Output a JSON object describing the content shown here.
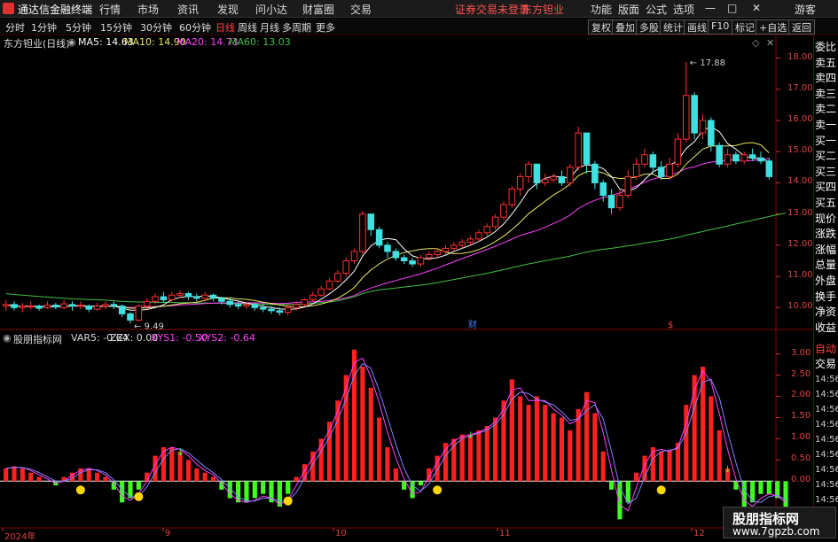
{
  "app_title": "通达信金融终端",
  "menu": [
    "行情",
    "市场",
    "资讯",
    "发现",
    "问小达",
    "财富圈",
    "交易"
  ],
  "notice": "证券交易未登录",
  "stock_name_top": "东方钽业",
  "menu_right": [
    "功能",
    "版面",
    "公式",
    "选项"
  ],
  "guest": "游客",
  "periods": [
    "分时",
    "1分钟",
    "5分钟",
    "15分钟",
    "30分钟",
    "60分钟",
    "日线",
    "周线",
    "月线",
    "多周期",
    "更多"
  ],
  "active_period": "日线",
  "toolbar_buttons": [
    "复权",
    "叠加",
    "多股",
    "统计",
    "画线",
    "F10",
    "标记",
    "+自选",
    "返回"
  ],
  "main_legend": {
    "title": "东方钽业(日线)",
    "ma5": "MA5: 14.63",
    "ma10": "MA10: 14.90",
    "ma20": "MA20: 14.73",
    "ma60": "MA60: 13.03"
  },
  "colors": {
    "ma5": "#ffffff",
    "ma10": "#e8e864",
    "ma20": "#ff40ff",
    "ma60": "#40c040",
    "up": "#ff3030",
    "down": "#40e0e0",
    "axis": "#d43030"
  },
  "price_axis": [
    "18.00",
    "17.00",
    "16.00",
    "15.00",
    "14.00",
    "13.00",
    "12.00",
    "11.00",
    "10.00"
  ],
  "high_mark": "17.88",
  "low_mark": "9.49",
  "chart_marks": [
    "财",
    "$"
  ],
  "indicator_legend": {
    "title": "股朋指标网",
    "var5": "VAR5: -0.64",
    "zzx": "ZZX: 0.00",
    "xys1": "XYS1: -0.50",
    "xys2": "XYS2: -0.64"
  },
  "ind_axis": [
    "3.00",
    "2.50",
    "2.00",
    "1.50",
    "1.00",
    "0.50",
    "0.00"
  ],
  "x_axis": [
    "2024年",
    "9",
    "10",
    "11",
    "12"
  ],
  "side_panel": [
    "委比",
    "卖五",
    "卖四",
    "卖三",
    "卖二",
    "卖一",
    "买一",
    "买二",
    "买三",
    "买四",
    "买五",
    "现价",
    "涨跌",
    "涨幅",
    "总量",
    "外盘",
    "换手",
    "净资",
    "收益"
  ],
  "side_lower": [
    "自动",
    "交易",
    "14:56",
    "14:56",
    "14:56",
    "14:56",
    "14:56",
    "14:56",
    "14:56",
    "14:56",
    "14:56"
  ],
  "watermark": {
    "line1": "股朋指标网",
    "line2": "www.7gpzb.com"
  },
  "chart_data": {
    "type": "candlestick",
    "price_ylim": [
      9.3,
      18.3
    ],
    "ind_ylim": [
      -1.1,
      3.2
    ],
    "candles": [
      [
        10.05,
        10.1,
        10.25,
        9.9
      ],
      [
        10.1,
        10.0,
        10.2,
        9.9
      ],
      [
        10.0,
        10.05,
        10.15,
        9.85
      ],
      [
        10.05,
        10.05,
        10.2,
        9.95
      ],
      [
        10.05,
        9.98,
        10.1,
        9.9
      ],
      [
        10.0,
        10.08,
        10.2,
        9.95
      ],
      [
        10.08,
        10.02,
        10.15,
        9.95
      ],
      [
        10.0,
        10.12,
        10.25,
        9.95
      ],
      [
        10.1,
        10.05,
        10.2,
        9.9
      ],
      [
        10.05,
        10.08,
        10.2,
        9.95
      ],
      [
        10.05,
        9.95,
        10.1,
        9.85
      ],
      [
        9.95,
        10.05,
        10.15,
        9.9
      ],
      [
        10.05,
        10.1,
        10.2,
        9.95
      ],
      [
        10.1,
        10.05,
        10.2,
        9.95
      ],
      [
        10.05,
        9.8,
        10.1,
        9.7
      ],
      [
        9.8,
        9.6,
        9.85,
        9.49
      ],
      [
        9.6,
        10.05,
        10.1,
        9.55
      ],
      [
        10.05,
        10.2,
        10.3,
        9.95
      ],
      [
        10.2,
        10.35,
        10.45,
        10.1
      ],
      [
        10.35,
        10.25,
        10.5,
        10.15
      ],
      [
        10.25,
        10.4,
        10.5,
        10.2
      ],
      [
        10.4,
        10.45,
        10.55,
        10.3
      ],
      [
        10.45,
        10.35,
        10.5,
        10.25
      ],
      [
        10.35,
        10.3,
        10.45,
        10.2
      ],
      [
        10.3,
        10.4,
        10.5,
        10.2
      ],
      [
        10.4,
        10.3,
        10.45,
        10.2
      ],
      [
        10.3,
        10.2,
        10.35,
        10.1
      ],
      [
        10.2,
        10.1,
        10.3,
        10.0
      ],
      [
        10.1,
        10.05,
        10.2,
        9.95
      ],
      [
        10.05,
        10.1,
        10.2,
        9.95
      ],
      [
        10.1,
        10.0,
        10.15,
        9.9
      ],
      [
        10.0,
        9.95,
        10.1,
        9.85
      ],
      [
        9.95,
        9.9,
        10.05,
        9.8
      ],
      [
        9.9,
        9.85,
        10.0,
        9.75
      ],
      [
        9.85,
        10.0,
        10.1,
        9.75
      ],
      [
        10.0,
        10.1,
        10.2,
        9.9
      ],
      [
        10.1,
        10.25,
        10.3,
        10.05
      ],
      [
        10.25,
        10.4,
        10.5,
        10.2
      ],
      [
        10.4,
        10.6,
        10.7,
        10.35
      ],
      [
        10.6,
        10.85,
        10.95,
        10.55
      ],
      [
        10.85,
        11.1,
        11.2,
        10.8
      ],
      [
        11.1,
        11.5,
        11.6,
        11.0
      ],
      [
        11.5,
        11.8,
        11.9,
        11.4
      ],
      [
        11.8,
        13.0,
        13.1,
        11.7
      ],
      [
        13.0,
        12.5,
        13.0,
        12.3
      ],
      [
        12.5,
        12.0,
        12.6,
        11.9
      ],
      [
        12.0,
        11.8,
        12.1,
        11.6
      ],
      [
        11.8,
        11.6,
        11.9,
        11.5
      ],
      [
        11.6,
        11.5,
        11.7,
        11.4
      ],
      [
        11.5,
        11.4,
        11.6,
        11.3
      ],
      [
        11.4,
        11.6,
        11.7,
        11.3
      ],
      [
        11.6,
        11.7,
        11.8,
        11.5
      ],
      [
        11.7,
        11.8,
        11.9,
        11.6
      ],
      [
        11.8,
        11.9,
        12.0,
        11.7
      ],
      [
        11.9,
        12.0,
        12.1,
        11.8
      ],
      [
        12.0,
        12.1,
        12.2,
        11.9
      ],
      [
        12.1,
        12.2,
        12.3,
        12.0
      ],
      [
        12.2,
        12.4,
        12.5,
        12.1
      ],
      [
        12.4,
        12.6,
        12.7,
        12.3
      ],
      [
        12.6,
        12.9,
        13.0,
        12.5
      ],
      [
        12.9,
        13.3,
        13.4,
        12.8
      ],
      [
        13.3,
        13.8,
        13.9,
        13.2
      ],
      [
        13.8,
        14.2,
        14.3,
        13.6
      ],
      [
        14.2,
        14.6,
        14.7,
        14.0
      ],
      [
        14.6,
        14.0,
        14.6,
        13.8
      ],
      [
        14.0,
        14.1,
        14.3,
        13.9
      ],
      [
        14.1,
        14.2,
        14.3,
        14.0
      ],
      [
        14.2,
        14.0,
        14.4,
        13.9
      ],
      [
        14.0,
        14.5,
        14.6,
        13.9
      ],
      [
        14.5,
        15.6,
        15.8,
        14.4
      ],
      [
        15.6,
        14.6,
        15.6,
        14.3
      ],
      [
        14.6,
        14.0,
        14.7,
        13.8
      ],
      [
        14.0,
        13.6,
        14.1,
        13.4
      ],
      [
        13.6,
        13.2,
        13.8,
        13.0
      ],
      [
        13.2,
        13.6,
        13.8,
        13.1
      ],
      [
        13.6,
        14.2,
        14.4,
        13.5
      ],
      [
        14.2,
        14.6,
        14.8,
        14.1
      ],
      [
        14.6,
        14.9,
        15.1,
        14.5
      ],
      [
        14.9,
        14.5,
        15.0,
        14.3
      ],
      [
        14.5,
        14.2,
        14.7,
        14.1
      ],
      [
        14.2,
        14.6,
        14.8,
        14.1
      ],
      [
        14.6,
        15.4,
        15.6,
        14.5
      ],
      [
        15.4,
        16.8,
        17.88,
        15.3
      ],
      [
        16.8,
        15.6,
        16.9,
        15.4
      ],
      [
        15.6,
        16.0,
        16.2,
        15.4
      ],
      [
        16.0,
        15.2,
        16.1,
        15.0
      ],
      [
        15.2,
        14.6,
        15.3,
        14.5
      ],
      [
        14.6,
        14.9,
        15.1,
        14.5
      ],
      [
        14.9,
        14.7,
        15.0,
        14.6
      ],
      [
        14.7,
        14.9,
        15.0,
        14.6
      ],
      [
        14.9,
        14.8,
        15.1,
        14.7
      ],
      [
        14.8,
        14.7,
        15.0,
        14.6
      ],
      [
        14.7,
        14.2,
        14.8,
        14.1
      ]
    ],
    "ind_values": [
      0.3,
      0.35,
      0.3,
      0.2,
      0.1,
      0.0,
      -0.1,
      0.1,
      0.2,
      0.3,
      0.3,
      0.2,
      0.1,
      -0.2,
      -0.5,
      -0.4,
      -0.2,
      0.2,
      0.6,
      0.8,
      0.8,
      0.7,
      0.5,
      0.3,
      0.2,
      0.1,
      -0.2,
      -0.4,
      -0.5,
      -0.5,
      -0.4,
      -0.3,
      -0.5,
      -0.6,
      -0.3,
      0.1,
      0.4,
      0.7,
      1.0,
      1.4,
      1.9,
      2.5,
      3.1,
      2.7,
      2.2,
      1.5,
      0.8,
      0.3,
      -0.2,
      -0.4,
      -0.1,
      0.3,
      0.6,
      0.9,
      1.0,
      1.1,
      1.1,
      1.2,
      1.3,
      1.5,
      1.9,
      2.4,
      2.0,
      1.8,
      2.0,
      1.8,
      1.6,
      1.5,
      1.2,
      1.7,
      2.1,
      1.6,
      0.7,
      -0.2,
      -0.9,
      -0.5,
      0.2,
      0.6,
      0.8,
      0.7,
      0.7,
      0.9,
      1.8,
      2.5,
      2.7,
      2.0,
      1.2,
      0.3,
      -0.2,
      -0.7,
      -0.5,
      -0.3,
      -0.3,
      -0.4,
      -0.6
    ],
    "ma60": [
      10.45,
      10.42,
      10.4,
      10.38,
      10.36,
      10.34,
      10.32,
      10.3,
      10.28,
      10.27,
      10.26,
      10.25,
      10.24,
      10.22,
      10.2,
      10.19,
      10.18,
      10.18,
      10.17,
      10.17,
      10.17,
      10.16,
      10.16,
      10.15,
      10.15,
      10.14,
      10.14,
      10.13,
      10.13,
      10.12,
      10.12,
      10.11,
      10.1,
      10.1,
      10.1,
      10.11,
      10.12,
      10.14,
      10.16,
      10.18,
      10.22,
      10.28,
      10.35,
      10.45,
      10.52,
      10.57,
      10.6,
      10.63,
      10.66,
      10.69,
      10.72,
      10.75,
      10.8,
      10.85,
      10.9,
      10.95,
      11.0,
      11.05,
      11.1,
      11.16,
      11.22,
      11.28,
      11.34,
      11.4,
      11.45,
      11.5,
      11.55,
      11.6,
      11.65,
      11.72,
      11.78,
      11.83,
      11.87,
      11.9,
      11.94,
      11.98,
      12.02,
      12.07,
      12.11,
      12.15,
      12.2,
      12.25,
      12.32,
      12.38,
      12.44,
      12.5,
      12.56,
      12.62,
      12.68,
      12.74,
      12.8,
      12.86,
      12.92,
      12.98,
      13.03
    ]
  }
}
